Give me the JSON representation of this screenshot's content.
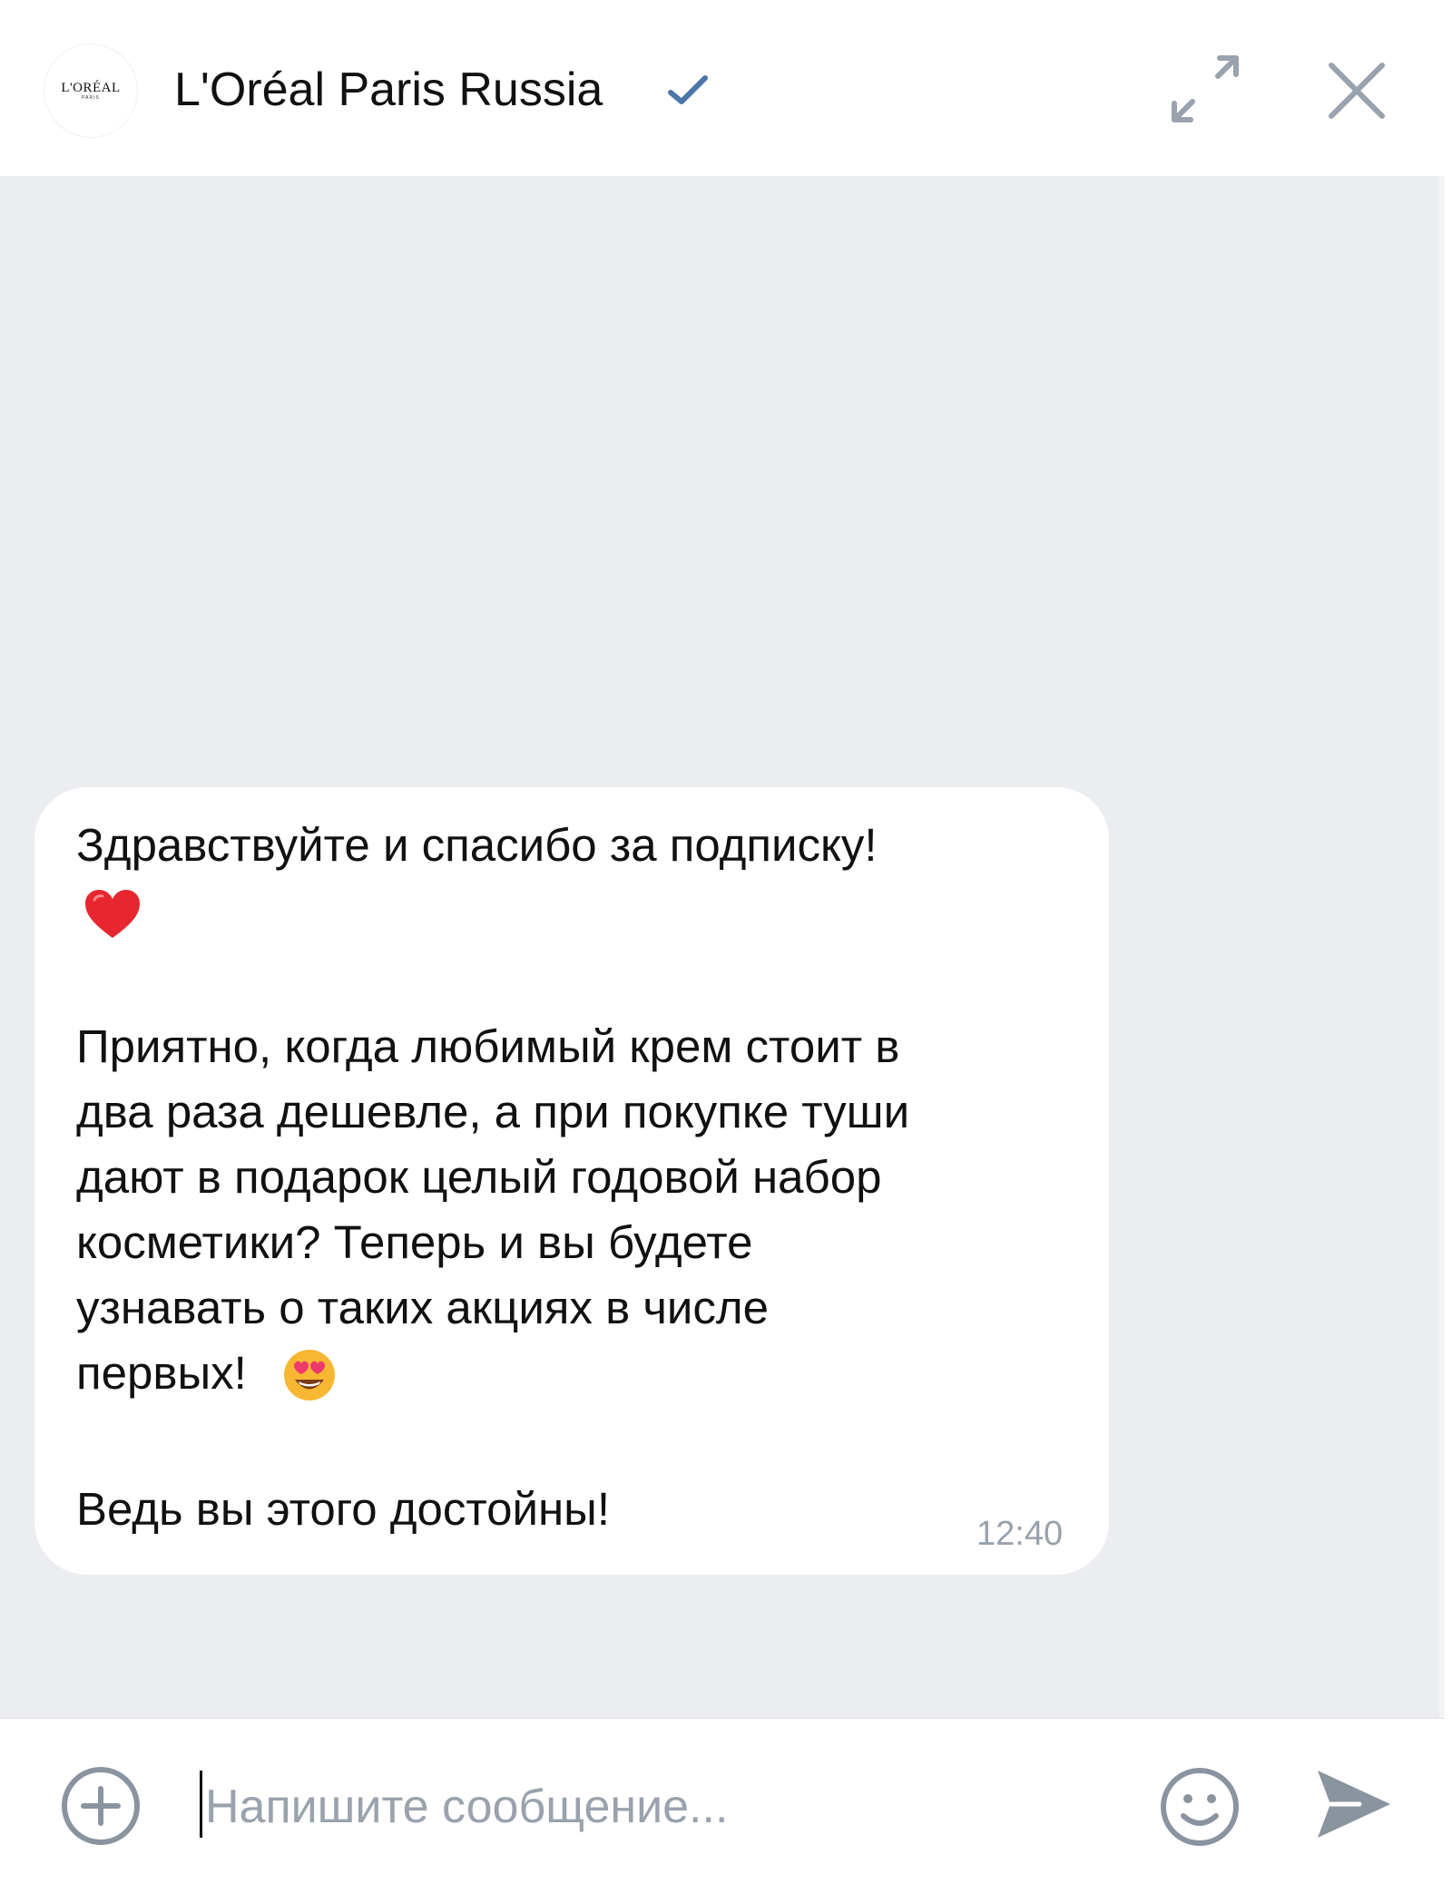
{
  "header": {
    "avatar_logo": "L'ORÉAL",
    "avatar_logo_sub": "PARIS",
    "title": "L'Oréal Paris Russia",
    "verified_icon": "verified-check-icon",
    "expand_icon": "expand-icon",
    "close_icon": "close-icon"
  },
  "message": {
    "lines": [
      "Здравствуйте и спасибо за подписку!",
      "Приятно, когда любимый крем стоит в",
      "два раза дешевле, а при покупке туши",
      "дают в подарок целый годовой набор",
      "косметики? Теперь и вы будете",
      "узнавать о таких акциях в числе",
      "первых!",
      "Ведь вы этого достойны!"
    ],
    "emoji_after_line_1": "red-heart-emoji",
    "emoji_after_first": "heart-eyes-emoji",
    "time": "12:40"
  },
  "composer": {
    "placeholder": "Напишите сообщение...",
    "value": "",
    "attach_icon": "plus-circle-icon",
    "emoji_icon": "smiley-icon",
    "send_icon": "send-icon"
  },
  "colors": {
    "background": "#ebedf0",
    "bubble": "#ffffff",
    "accent": "#4a76a8",
    "muted": "#99a2ad",
    "icon": "#8a949f"
  }
}
